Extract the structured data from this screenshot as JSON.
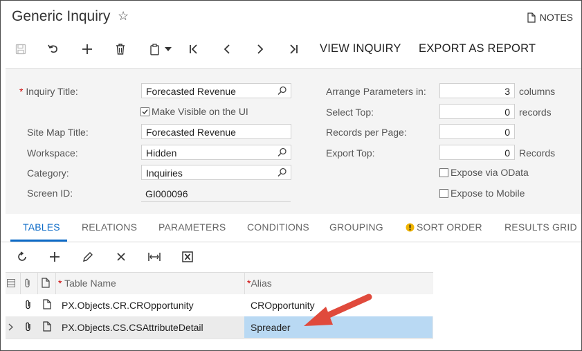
{
  "header": {
    "title": "Generic Inquiry",
    "notes_label": "NOTES"
  },
  "toolbar": {
    "view_inquiry": "VIEW INQUIRY",
    "export_as_report": "EXPORT AS REPORT"
  },
  "form": {
    "inquiry_title_label": "Inquiry Title:",
    "inquiry_title_value": "Forecasted Revenue",
    "make_visible_label": "Make Visible on the UI",
    "make_visible_checked": true,
    "site_map_title_label": "Site Map Title:",
    "site_map_title_value": "Forecasted Revenue",
    "workspace_label": "Workspace:",
    "workspace_value": "Hidden",
    "category_label": "Category:",
    "category_value": "Inquiries",
    "screen_id_label": "Screen ID:",
    "screen_id_value": "GI000096",
    "arrange_params_label": "Arrange Parameters in:",
    "arrange_params_value": "3",
    "arrange_params_unit": "columns",
    "select_top_label": "Select Top:",
    "select_top_value": "0",
    "select_top_unit": "records",
    "records_per_page_label": "Records per Page:",
    "records_per_page_value": "0",
    "export_top_label": "Export Top:",
    "export_top_value": "0",
    "export_top_unit": "Records",
    "expose_odata_label": "Expose via OData",
    "expose_mobile_label": "Expose to Mobile"
  },
  "tabs": [
    {
      "label": "TABLES"
    },
    {
      "label": "RELATIONS"
    },
    {
      "label": "PARAMETERS"
    },
    {
      "label": "CONDITIONS"
    },
    {
      "label": "GROUPING"
    },
    {
      "label": "SORT ORDER"
    },
    {
      "label": "RESULTS GRID"
    }
  ],
  "grid": {
    "columns": {
      "table_name": "Table Name",
      "alias": "Alias"
    },
    "rows": [
      {
        "table_name": "PX.Objects.CR.CROpportunity",
        "alias": "CROpportunity"
      },
      {
        "table_name": "PX.Objects.CS.CSAttributeDetail",
        "alias": "Spreader"
      }
    ]
  },
  "colors": {
    "accent": "#0b6ac7",
    "selected_cell": "#b9d9f3",
    "arrow": "#e04a3c",
    "warning": "#f0b400"
  }
}
